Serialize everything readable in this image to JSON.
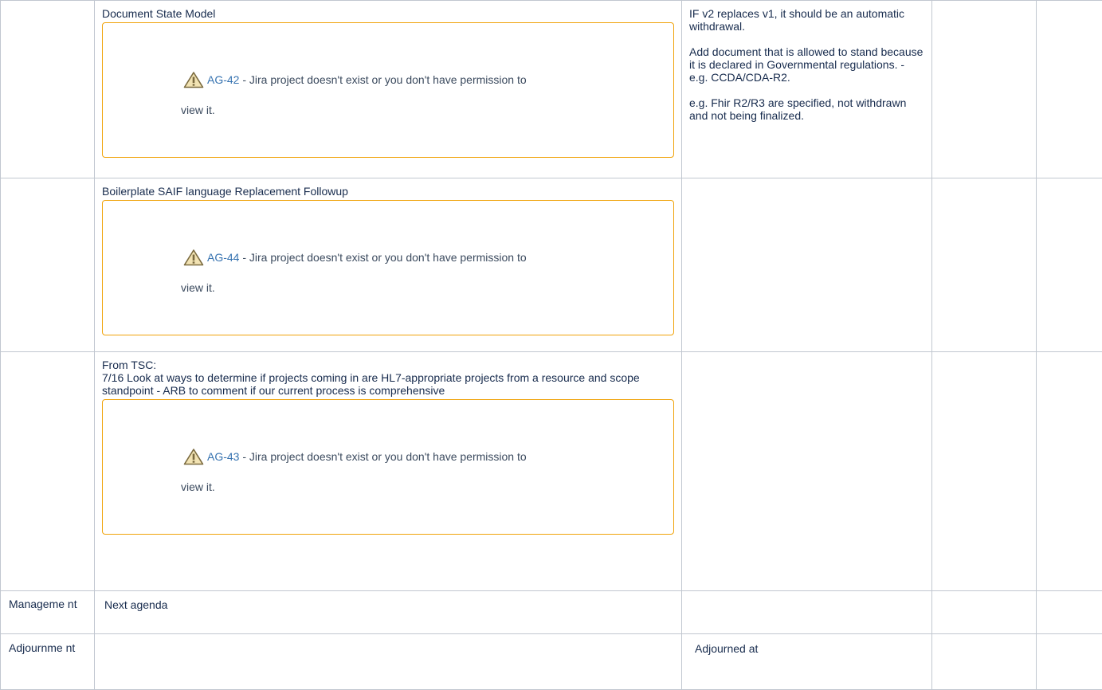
{
  "rows": {
    "doc_state": {
      "title": "Document State Model",
      "jira": {
        "key": "AG-42",
        "message_line1": " - Jira project doesn't exist or you don't have permission to",
        "message_line2": "view it."
      },
      "notes": [
        "IF v2 replaces v1, it should be an automatic withdrawal.",
        "Add document that is allowed to stand because it is declared in Governmental regulations.  - e.g. CCDA/CDA-R2.",
        "e.g. Fhir R2/R3 are specified, not withdrawn and not being finalized."
      ]
    },
    "boilerplate": {
      "title": "Boilerplate SAIF language Replacement Followup",
      "jira": {
        "key": "AG-44",
        "message_line1": " - Jira project doesn't exist or you don't have permission to",
        "message_line2": "view it."
      }
    },
    "tsc": {
      "title": "From TSC:",
      "text": "7/16 Look at ways to determine if projects coming in are HL7-appropriate projects from a resource and scope standpoint - ARB to comment if our current process is comprehensive",
      "jira": {
        "key": "AG-43",
        "message_line1": " - Jira project doesn't exist or you don't have permission to",
        "message_line2": "view it."
      }
    },
    "management": {
      "label": "Manageme nt",
      "agenda": "Next agenda"
    },
    "adjournment": {
      "label": "Adjournme nt",
      "notes": "Adjourned at"
    }
  },
  "icons": {
    "warning": "warning-triangle-icon"
  },
  "colors": {
    "jira_link": "#3572b0",
    "macro_border": "#f0a30a",
    "table_border": "#c1c7d0"
  }
}
